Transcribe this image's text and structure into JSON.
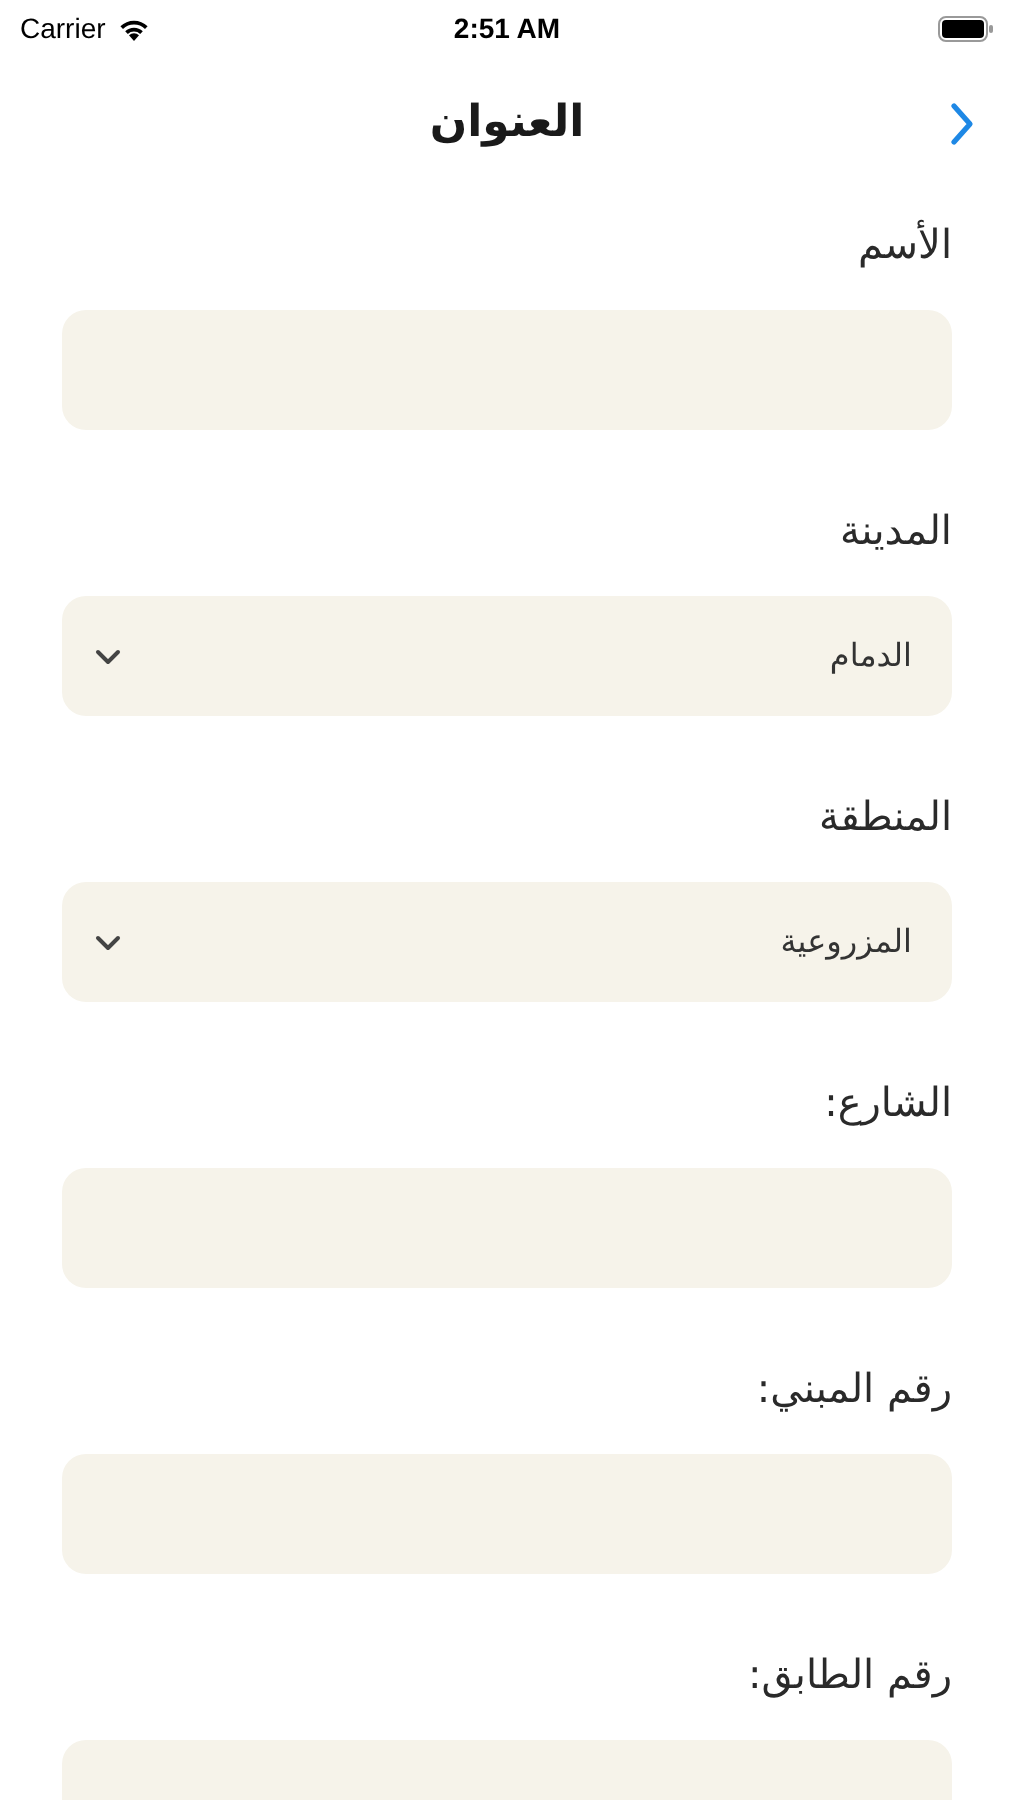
{
  "status_bar": {
    "carrier": "Carrier",
    "time": "2:51 AM"
  },
  "nav": {
    "title": "العنوان"
  },
  "fields": [
    {
      "label": "الأسم",
      "kind": "text"
    },
    {
      "label": "المدينة",
      "kind": "select",
      "value": "الدمام"
    },
    {
      "label": "المنطقة",
      "kind": "select",
      "value": "المزروعية"
    },
    {
      "label": "الشارع:",
      "kind": "text"
    },
    {
      "label": "رقم المبني:",
      "kind": "text"
    },
    {
      "label": "رقم الطابق:",
      "kind": "text"
    }
  ]
}
